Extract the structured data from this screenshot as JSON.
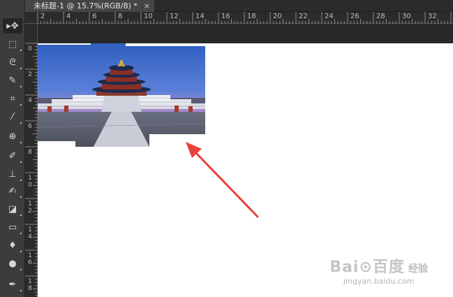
{
  "document_tab": {
    "title": "未标题-1 @ 15.7%(RGB/8) *",
    "close_glyph": "×"
  },
  "rulers": {
    "top_labels": [
      "2",
      "4",
      "6",
      "8",
      "10",
      "12",
      "14",
      "16",
      "18",
      "20",
      "22",
      "24",
      "26",
      "28",
      "30",
      "32"
    ],
    "left_labels": [
      "0",
      "2",
      "4",
      "6",
      "8",
      "1\n0",
      "1\n2",
      "1\n4",
      "1\n6",
      "1\n8"
    ]
  },
  "tools": [
    {
      "name": "move-tool",
      "icon": "move-icon",
      "glyph": "▸✥",
      "active": true
    },
    {
      "name": "marquee-tool",
      "icon": "rect-marquee-icon",
      "glyph": "⬚"
    },
    {
      "name": "lasso-tool",
      "icon": "lasso-icon",
      "glyph": "ᘓ"
    },
    {
      "name": "quick-select-tool",
      "icon": "quick-select-icon",
      "glyph": "✎"
    },
    {
      "name": "crop-tool",
      "icon": "crop-icon",
      "glyph": "⌗"
    },
    {
      "name": "eyedropper-tool",
      "icon": "eyedropper-icon",
      "glyph": "⁄"
    },
    {
      "name": "healing-tool",
      "icon": "healing-icon",
      "glyph": "⊕"
    },
    {
      "name": "brush-tool",
      "icon": "brush-icon",
      "glyph": "✐"
    },
    {
      "name": "stamp-tool",
      "icon": "stamp-icon",
      "glyph": "⊥"
    },
    {
      "name": "history-brush-tool",
      "icon": "history-brush-icon",
      "glyph": "✍"
    },
    {
      "name": "eraser-tool",
      "icon": "eraser-icon",
      "glyph": "◪"
    },
    {
      "name": "gradient-tool",
      "icon": "gradient-icon",
      "glyph": "▭"
    },
    {
      "name": "smudge-tool",
      "icon": "smudge-icon",
      "glyph": "♦"
    },
    {
      "name": "dodge-tool",
      "icon": "dodge-icon",
      "glyph": "●"
    },
    {
      "name": "pen-tool",
      "icon": "pen-icon",
      "glyph": "✒"
    }
  ],
  "watermark": {
    "logo": "Bai⊙百度",
    "caption": "经验",
    "url": "jingyan.baidu.com"
  },
  "colors": {
    "panel": "#3c3c3c",
    "workspace": "#282828",
    "canvas": "#ffffff",
    "arrow": "#e8413a"
  }
}
